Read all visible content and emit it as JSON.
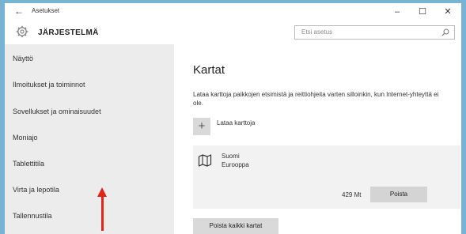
{
  "window": {
    "title": "Asetukset",
    "back_glyph": "←",
    "minimize_glyph": "–",
    "maximize_glyph": "☐",
    "close_glyph": "✕"
  },
  "header": {
    "title": "JÄRJESTELMÄ",
    "icon": "gear-icon"
  },
  "search": {
    "placeholder": "Etsi asetus",
    "icon": "search-icon"
  },
  "sidebar": {
    "items": [
      {
        "label": "Näyttö"
      },
      {
        "label": "Ilmoitukset ja toiminnot"
      },
      {
        "label": "Sovellukset ja ominaisuudet"
      },
      {
        "label": "Moniajo"
      },
      {
        "label": "Tablettitila"
      },
      {
        "label": "Virta ja lepotila"
      },
      {
        "label": "Tallennustila"
      }
    ]
  },
  "annotation": {
    "arrow_color": "#e2231a"
  },
  "main": {
    "title": "Kartat",
    "description": "Lataa karttoja paikkojen etsimistä ja reittiohjeita varten silloinkin, kun Internet-yhteyttä ei ole.",
    "add_button_glyph": "+",
    "add_label": "Lataa karttoja",
    "maps": [
      {
        "name": "Suomi",
        "region": "Eurooppa",
        "size": "429 Mt",
        "remove_label": "Poista",
        "icon": "map-icon"
      }
    ],
    "remove_all_label": "Poista kaikki kartat"
  }
}
